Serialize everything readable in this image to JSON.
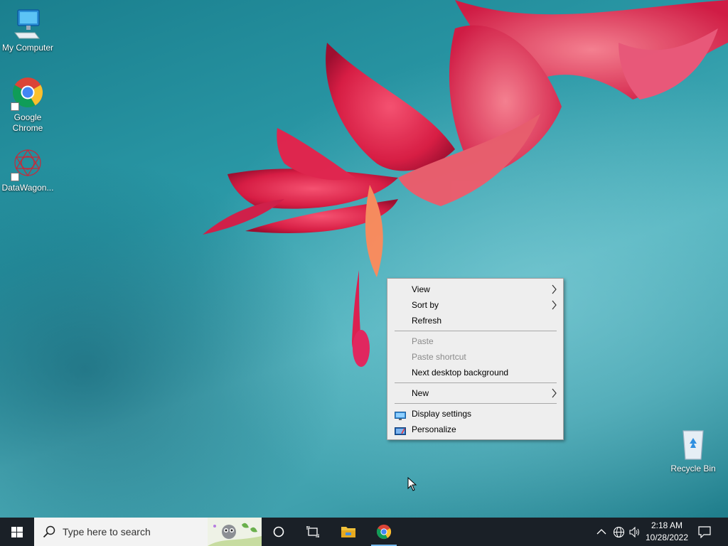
{
  "desktop": {
    "icons": [
      {
        "label": "My Computer"
      },
      {
        "label": "Google\nChrome"
      },
      {
        "label": "DataWagon..."
      },
      {
        "label": "Recycle Bin"
      }
    ]
  },
  "context_menu": {
    "items": [
      {
        "label": "View",
        "submenu": true
      },
      {
        "label": "Sort by",
        "submenu": true
      },
      {
        "label": "Refresh"
      },
      {
        "label": "Paste",
        "disabled": true
      },
      {
        "label": "Paste shortcut",
        "disabled": true
      },
      {
        "label": "Next desktop background"
      },
      {
        "label": "New",
        "submenu": true
      },
      {
        "label": "Display settings",
        "icon": "display-icon"
      },
      {
        "label": "Personalize",
        "icon": "personalize-icon"
      }
    ]
  },
  "taskbar": {
    "search_placeholder": "Type here to search",
    "time": "2:18 AM",
    "date": "10/28/2022"
  },
  "colors": {
    "taskbar_bg": "#1a2027",
    "menu_bg": "#eeeeee",
    "accent_blue": "#0078d7"
  }
}
